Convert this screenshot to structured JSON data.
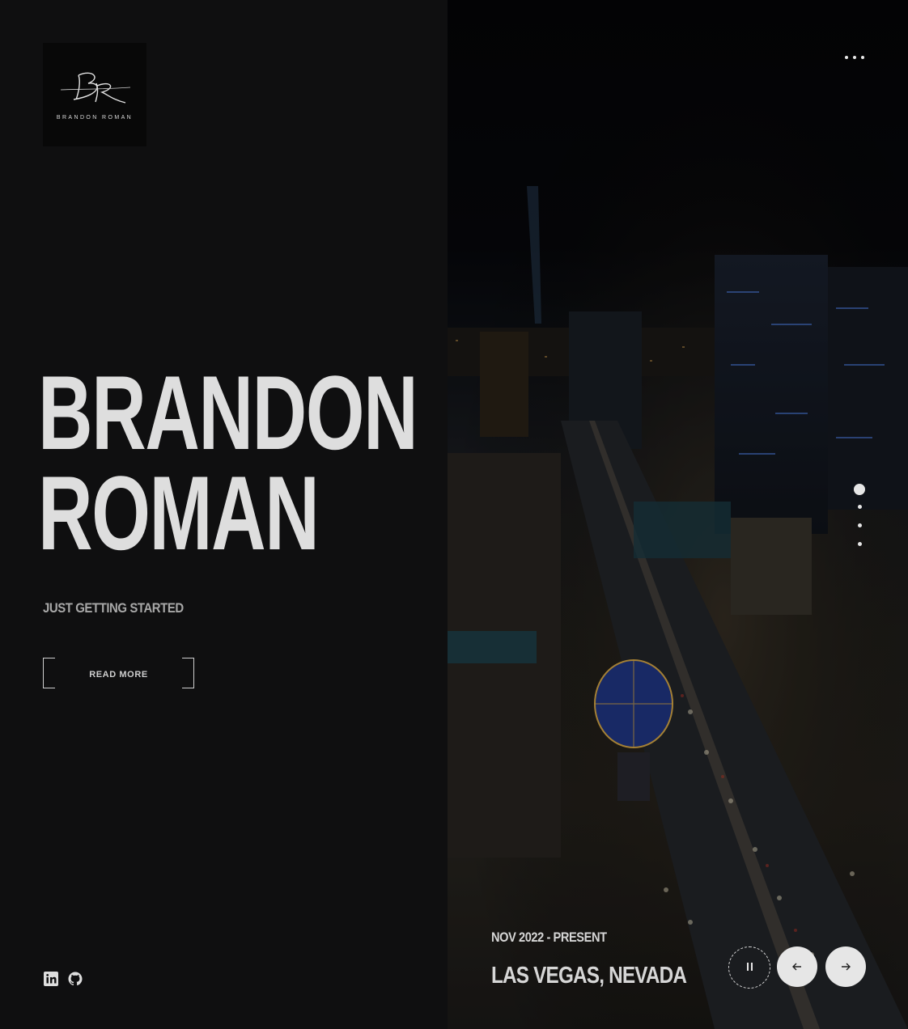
{
  "brand": {
    "monogram": "BR",
    "logo_text": "BRANDON ROMAN"
  },
  "hero": {
    "title_line1": "BRANDON",
    "title_line2": "ROMAN",
    "subtitle": "JUST GETTING STARTED",
    "read_more_label": "READ MORE"
  },
  "social": {
    "items": [
      {
        "icon": "linkedin-icon"
      },
      {
        "icon": "github-icon"
      }
    ]
  },
  "slide": {
    "date": "NOV 2022 - PRESENT",
    "location": "LAS VEGAS, NEVADA",
    "image": "las-vegas-strip-night-aerial"
  },
  "slider": {
    "total_slides": 4,
    "active_slide": 1
  },
  "controls": {
    "pause_icon": "pause-icon",
    "prev_icon": "arrow-left-icon",
    "next_icon": "arrow-right-icon",
    "menu_icon": "more-horizontal-icon"
  },
  "colors": {
    "background": "#0f0f10",
    "text": "#dedede",
    "muted": "#a8a8a8",
    "button": "#e6e6e6"
  }
}
